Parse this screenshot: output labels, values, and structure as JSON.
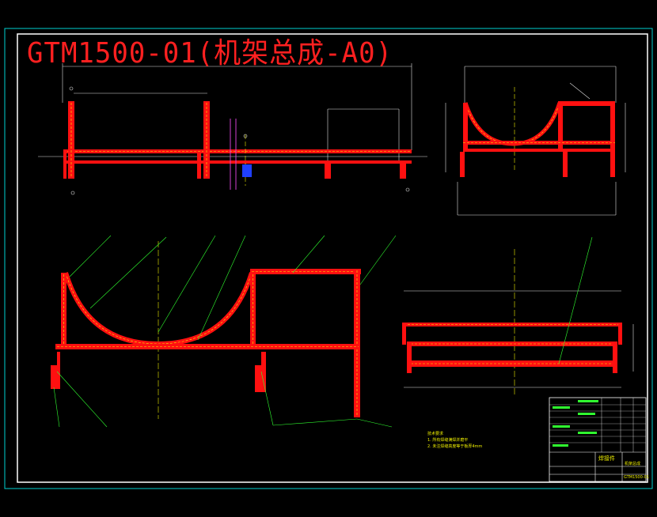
{
  "drawing": {
    "title": "GTM1500-01(机架总成-A0)",
    "colors": {
      "background": "#000000",
      "frame": "#ffffff",
      "outer_border": "#00d0d0",
      "steel_fill": "#ff1010",
      "hidden_line": "#f0f000",
      "dimension": "#f0f0f0",
      "leader": "#30ff30",
      "center_line": "#f0f000",
      "marker_magenta": "#d040d0",
      "marker_blue": "#2040ff"
    }
  },
  "notes": {
    "heading": "技术要求",
    "lines": [
      "1. 所有焊缝满焊并磨平",
      "2. 未注焊缝高度等于板厚4mm"
    ]
  },
  "title_block": {
    "part_name": "机架总成",
    "drawing_no": "GTM1500-01",
    "label": "焊接件"
  }
}
